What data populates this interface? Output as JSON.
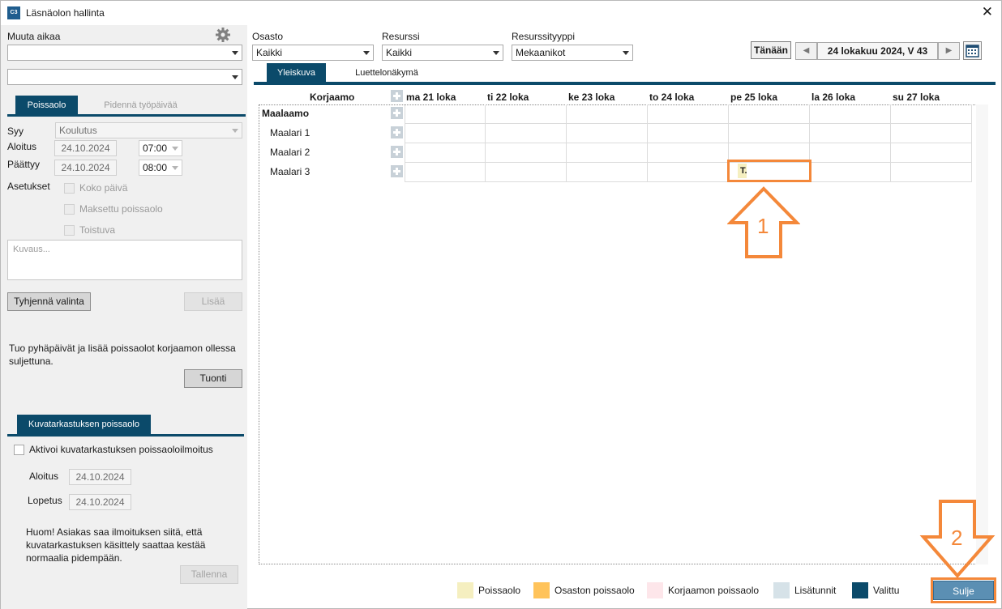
{
  "window": {
    "title": "Läsnäolon hallinta",
    "app_icon_text": "C3"
  },
  "left_panel": {
    "change_time_label": "Muuta aikaa",
    "combo1_value": "",
    "combo2_value": "",
    "tabs": {
      "absence": "Poissaolo",
      "extend": "Pidennä työpäivää"
    },
    "reason_label": "Syy",
    "reason_value": "Koulutus",
    "start_label": "Aloitus",
    "start_date": "24.10.2024",
    "start_time": "07:00",
    "end_label": "Päättyy",
    "end_date": "24.10.2024",
    "end_time": "08:00",
    "settings_label": "Asetukset",
    "settings": [
      "Koko päivä",
      "Maksettu poissaolo",
      "Toistuva"
    ],
    "description_placeholder": "Kuvaus...",
    "clear_button": "Tyhjennä valinta",
    "add_button": "Lisää",
    "import_note": "Tuo pyhäpäivät ja lisää poissaolot korjaamon ollessa suljettuna.",
    "import_button": "Tuonti",
    "inspection_tab": "Kuvatarkastuksen poissaolo",
    "activate_label": "Aktivoi kuvatarkastuksen poissaoloilmoitus",
    "insp_start_label": "Aloitus",
    "insp_start_date": "24.10.2024",
    "insp_end_label": "Lopetus",
    "insp_end_date": "24.10.2024",
    "notice": "Huom! Asiakas saa ilmoituksen siitä, että kuvatarkastuksen käsittely saattaa kestää normaalia pidempään.",
    "save_button": "Tallenna"
  },
  "filters": {
    "department_label": "Osasto",
    "department_value": "Kaikki",
    "resource_label": "Resurssi",
    "resource_value": "Kaikki",
    "resource_type_label": "Resurssityyppi",
    "resource_type_value": "Mekaanikot"
  },
  "nav": {
    "today_button": "Tänään",
    "prev_icon": "◀",
    "next_icon": "▶",
    "date_label": "24 lokakuu 2024, V 43"
  },
  "view_tabs": {
    "overview": "Yleiskuva",
    "list": "Luettelonäkymä"
  },
  "grid": {
    "first_column": "Korjaamo",
    "days": [
      "ma 21 loka",
      "ti 22 loka",
      "ke 23 loka",
      "to 24 loka",
      "pe 25 loka",
      "la 26 loka",
      "su 27 loka"
    ],
    "group": "Maalaamo",
    "rows": [
      "Maalari 1",
      "Maalari 2",
      "Maalari 3"
    ],
    "event_text": "T."
  },
  "legend": {
    "items": [
      {
        "label": "Poissaolo",
        "color": "#f5efc0"
      },
      {
        "label": "Osaston poissaolo",
        "color": "#ffc35a"
      },
      {
        "label": "Korjaamon poissaolo",
        "color": "#fde6ea"
      },
      {
        "label": "Lisätunnit",
        "color": "#d6e2e8"
      },
      {
        "label": "Valittu",
        "color": "#0b4a6a"
      }
    ]
  },
  "close_button": "Sulje",
  "annotations": {
    "one": "1",
    "two": "2",
    "color": "#f4883a"
  }
}
